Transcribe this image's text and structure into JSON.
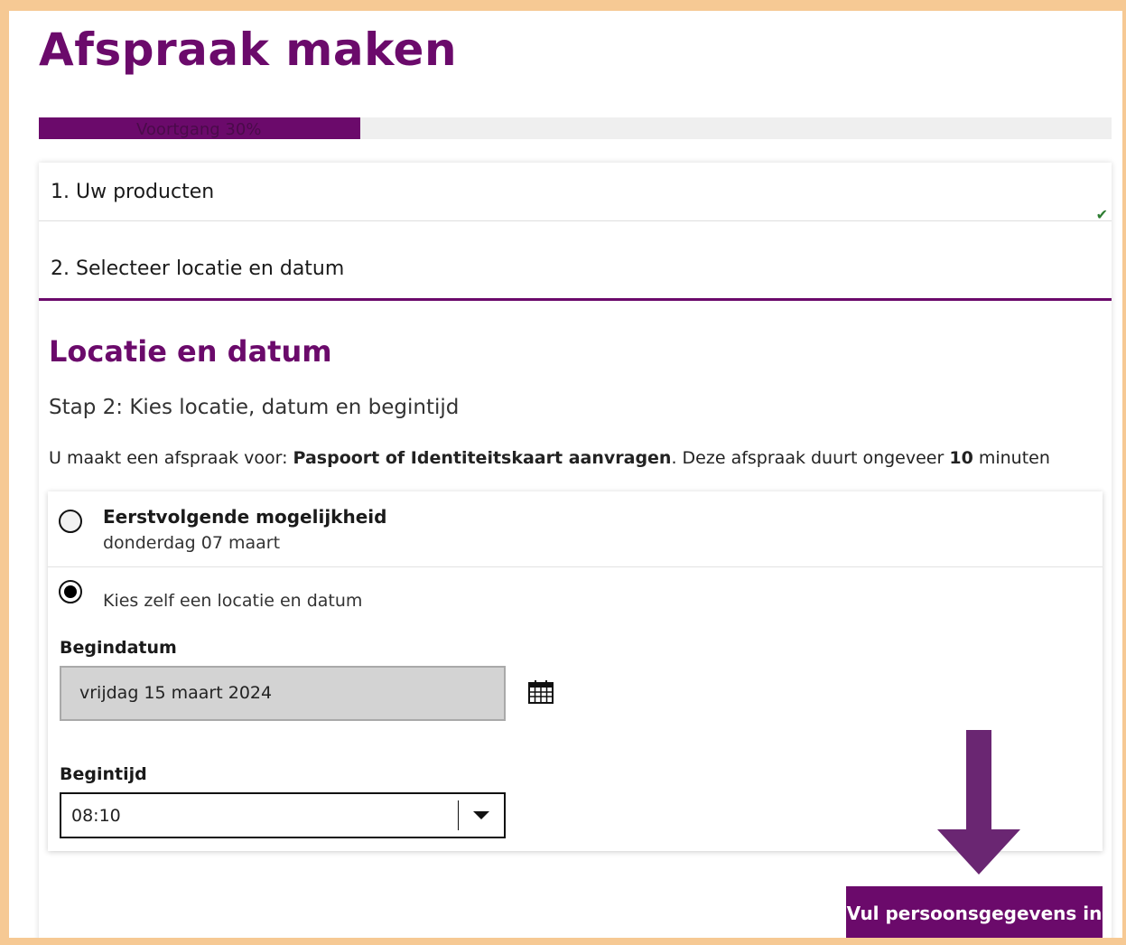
{
  "page": {
    "title": "Afspraak maken"
  },
  "progress": {
    "label": "Voortgang 30%",
    "percent": 30
  },
  "steps": [
    {
      "label": "1. Uw producten",
      "completed": true
    },
    {
      "label": "2. Selecteer locatie en datum",
      "completed": false
    }
  ],
  "section": {
    "title": "Locatie en datum",
    "subtitle": "Stap 2: Kies locatie, datum en begintijd",
    "info_prefix": "U maakt een afspraak voor: ",
    "info_product": "Paspoort of Identiteitskaart aanvragen",
    "info_middle": ". Deze afspraak duurt ongeveer ",
    "info_duration": "10",
    "info_suffix": " minuten"
  },
  "options": {
    "first": {
      "title": "Eerstvolgende mogelijkheid",
      "subtitle": "donderdag 07 maart",
      "selected": false
    },
    "custom": {
      "label": "Kies zelf een locatie en datum",
      "selected": true
    }
  },
  "start_date": {
    "label": "Begindatum",
    "value": "vrijdag 15 maart 2024",
    "icon": "calendar-icon"
  },
  "start_time": {
    "label": "Begintijd",
    "value": "08:10"
  },
  "next_button": {
    "label": "Vul persoonsgegevens in"
  },
  "colors": {
    "brand": "#6b0a6b",
    "frame": "#f6c994",
    "success": "#2e7d32"
  }
}
